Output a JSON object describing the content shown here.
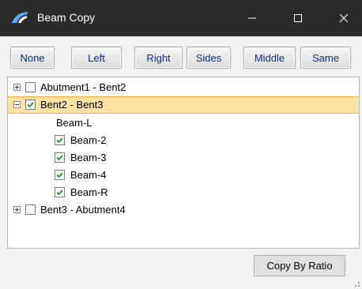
{
  "window": {
    "title": "Beam Copy"
  },
  "toolbar": {
    "buttons": [
      "None",
      "Left",
      "Right",
      "Sides",
      "Middle",
      "Same"
    ]
  },
  "tree": {
    "nodes": [
      {
        "label": "Abutment1 - Bent2",
        "expanded": false,
        "checked": false
      },
      {
        "label": "Bent2 - Bent3",
        "expanded": true,
        "checked": true,
        "selected": true,
        "children": [
          {
            "label": "Beam-L",
            "has_checkbox": false
          },
          {
            "label": "Beam-2",
            "checked": true
          },
          {
            "label": "Beam-3",
            "checked": true
          },
          {
            "label": "Beam-4",
            "checked": true
          },
          {
            "label": "Beam-R",
            "checked": true
          }
        ]
      },
      {
        "label": "Bent3 - Abutment4",
        "expanded": false,
        "checked": false
      }
    ]
  },
  "footer": {
    "copy_by_ratio_label": "Copy By Ratio"
  },
  "colors": {
    "titlebar": "#2b2b2b",
    "selection": "#fde3a3",
    "button_text": "#0c2d8a",
    "check": "#1a8e2c"
  }
}
